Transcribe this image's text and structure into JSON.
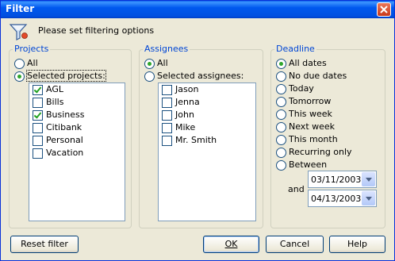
{
  "window": {
    "title": "Filter"
  },
  "header": {
    "text": "Please set filtering options",
    "icon": "funnel-icon"
  },
  "projects": {
    "legend": "Projects",
    "options": [
      {
        "label": "All",
        "selected": false
      },
      {
        "label": "Selected projects:",
        "selected": true
      }
    ],
    "items": [
      {
        "label": "AGL",
        "checked": true
      },
      {
        "label": "Bills",
        "checked": false
      },
      {
        "label": "Business",
        "checked": true
      },
      {
        "label": "Citibank",
        "checked": false
      },
      {
        "label": "Personal",
        "checked": false
      },
      {
        "label": "Vacation",
        "checked": false
      }
    ]
  },
  "assignees": {
    "legend": "Assignees",
    "options": [
      {
        "label": "All",
        "selected": true
      },
      {
        "label": "Selected assignees:",
        "selected": false
      }
    ],
    "items": [
      {
        "label": "Jason",
        "checked": false
      },
      {
        "label": "Jenna",
        "checked": false
      },
      {
        "label": "John",
        "checked": false
      },
      {
        "label": "Mike",
        "checked": false
      },
      {
        "label": "Mr. Smith",
        "checked": false
      }
    ]
  },
  "deadline": {
    "legend": "Deadline",
    "options": [
      {
        "label": "All dates",
        "selected": true
      },
      {
        "label": "No due dates",
        "selected": false
      },
      {
        "label": "Today",
        "selected": false
      },
      {
        "label": "Tomorrow",
        "selected": false
      },
      {
        "label": "This week",
        "selected": false
      },
      {
        "label": "Next week",
        "selected": false
      },
      {
        "label": "This month",
        "selected": false
      },
      {
        "label": "Recurring only",
        "selected": false
      },
      {
        "label": "Between",
        "selected": false
      }
    ],
    "from_date": "03/11/2003",
    "and_label": "and",
    "to_date": "04/13/2003"
  },
  "buttons": {
    "reset": "Reset filter",
    "ok": "OK",
    "cancel": "Cancel",
    "help": "Help"
  },
  "colors": {
    "titlebar": "#0058ee",
    "legend": "#0046d5",
    "radio_dot": "#2ea62c"
  }
}
